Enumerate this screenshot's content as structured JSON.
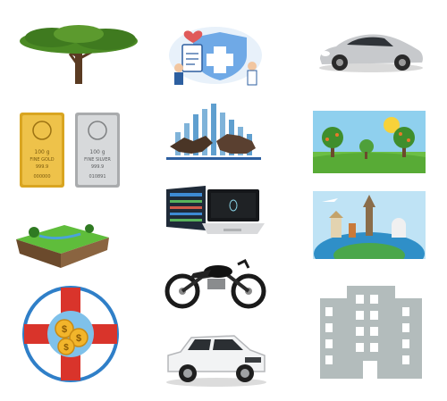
{
  "grid": {
    "icons": [
      {
        "name": "acacia-tree"
      },
      {
        "name": "medical-insurance"
      },
      {
        "name": "sports-car"
      },
      {
        "name": "gold-silver-bars"
      },
      {
        "name": "bull-bear-market"
      },
      {
        "name": "park-landscape"
      },
      {
        "name": "land-plot"
      },
      {
        "name": "trading-laptop"
      },
      {
        "name": "travel-landmarks"
      },
      {
        "name": "motorcycle"
      },
      {
        "name": "coin-lifebuoy"
      },
      {
        "name": "suv"
      },
      {
        "name": "building"
      }
    ]
  },
  "bars": {
    "gold": {
      "lines": [
        "100 g",
        "FINE GOLD",
        "999.9",
        "000000"
      ]
    },
    "silver": {
      "lines": [
        "100 g",
        "FINE SILVER",
        "999.9",
        "010891"
      ]
    }
  },
  "colors": {
    "gold": "#d9a521",
    "silver": "#c9cbcd",
    "lifebuoy_red": "#d9342b",
    "building_gray": "#b3bcbc",
    "tree_green": "#3f7a1f",
    "car_silver": "#c7c9cc"
  }
}
